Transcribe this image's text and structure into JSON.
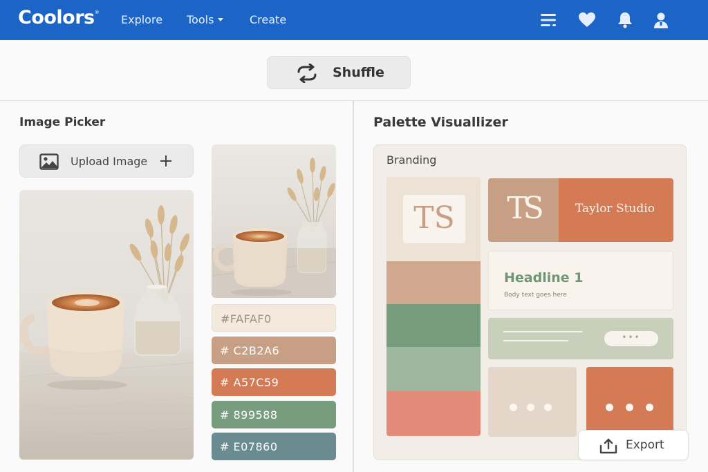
{
  "app": {
    "logo": "Coolors",
    "logo_mark": "®"
  },
  "nav": {
    "items": [
      {
        "label": "Explore"
      },
      {
        "label": "Tools",
        "has_dropdown": true
      },
      {
        "label": "Create"
      }
    ],
    "icons": [
      "list-icon",
      "heart-icon",
      "bell-icon",
      "user-icon"
    ],
    "bar_color": "#1c65c6"
  },
  "toolbar": {
    "shuffle_label": "Shuffle",
    "shuffle_icon": "shuffle-icon"
  },
  "image_picker": {
    "title": "Image Picker",
    "upload_label": "Upload Image",
    "upload_icon": "image-icon",
    "add_icon": "plus-icon",
    "swatches": [
      {
        "hash": "#",
        "hex": "FAFAF0",
        "color": "#f3e9dd"
      },
      {
        "hash": "#",
        "hex": "C2B2A6",
        "color": "#c79f84"
      },
      {
        "hash": "#",
        "hex": "A57C59",
        "color": "#d47a54"
      },
      {
        "hash": "#",
        "hex": "899588",
        "color": "#789d7e"
      },
      {
        "hash": "#",
        "hex": "E07860",
        "color": "#6a8b8f"
      }
    ]
  },
  "visualizer": {
    "title": "Palette Visuallizer",
    "section_label": "Branding",
    "monogram": "TS",
    "logo_monogram": "TS",
    "studio_name": "Taylor Studio",
    "headline": "Headline 1",
    "body_text": "Body text goes here",
    "pill_text": "•••",
    "export_label": "Export",
    "export_icon": "upload-icon"
  }
}
